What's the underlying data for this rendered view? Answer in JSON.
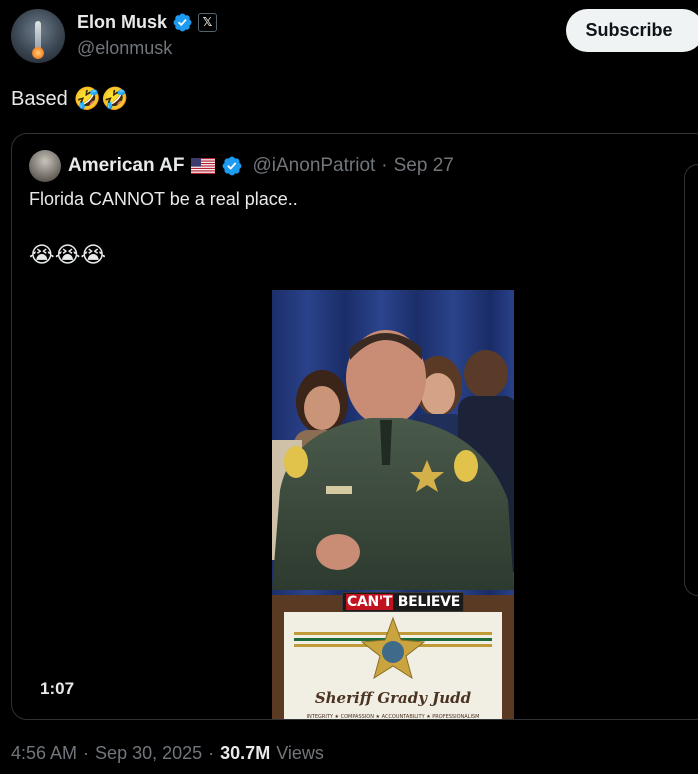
{
  "author": {
    "display_name": "Elon Musk",
    "handle": "@elonmusk",
    "x_badge": "𝕏",
    "verified_color": "#1d9bf0"
  },
  "subscribe_label": "Subscribe",
  "post": {
    "text": "Based",
    "emojis": "🤣🤣"
  },
  "quote": {
    "display_name": "American AF",
    "handle": "@iAnonPatriot",
    "separator": "·",
    "date": "Sep 27",
    "text": "Florida CANNOT be a real place..",
    "emojis": "😭😭😭",
    "video": {
      "duration": "1:07",
      "caption_highlight": "CAN'T",
      "caption_rest": "BELIEVE",
      "podium_text": "Sheriff Grady Judd",
      "podium_mottos": "INTEGRITY ★ COMPASSION ★ ACCOUNTABILITY ★ PROFESSIONALISM"
    }
  },
  "meta": {
    "time": "4:56 AM",
    "sep1": "·",
    "date": "Sep 30, 2025",
    "sep2": "·",
    "views": "30.7M",
    "views_label": "Views"
  },
  "colors": {
    "background": "#000000",
    "text_primary": "#e7e9ea",
    "text_secondary": "#71767b",
    "border": "#2f3336",
    "button_bg": "#eff3f4"
  }
}
